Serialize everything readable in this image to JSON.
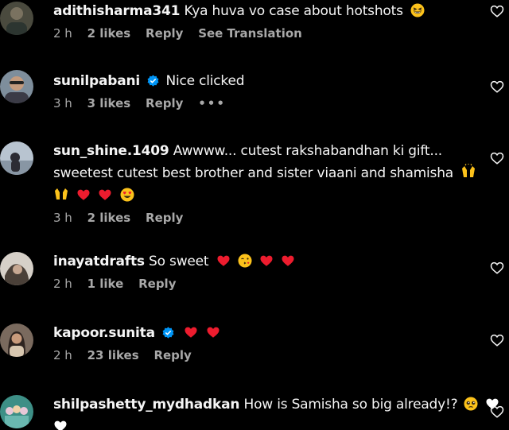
{
  "comments": [
    {
      "username": "adithisharma341",
      "text": "Kya huva vo case about hotshots",
      "emojis": [
        "grinning-squinting-face"
      ],
      "time": "2 h",
      "likes": "2 likes",
      "reply": "Reply",
      "extra": "See Translation",
      "avatar_color": "#5a5a4a"
    },
    {
      "username": "sunilpabani",
      "verified": true,
      "text": "Nice clicked",
      "time": "3 h",
      "likes": "3 likes",
      "reply": "Reply",
      "more": "•••",
      "avatar_color": "#6b7b8a"
    },
    {
      "username": "sun_shine.1409",
      "text": "Awwww... cutest rakshabandhan ki gift...",
      "text2": "sweetest cutest best brother and sister viaani and shamisha",
      "emojis_line2": [
        "raising-hands"
      ],
      "emojis_line3": [
        "raising-hands",
        "red-heart",
        "red-heart",
        "heart-eyes-face"
      ],
      "time": "3 h",
      "likes": "2 likes",
      "reply": "Reply",
      "avatar_color": "#9aa6b4"
    },
    {
      "username": "inayatdrafts",
      "text": "So sweet",
      "emojis": [
        "red-heart",
        "face-blowing-kiss",
        "red-heart",
        "red-heart"
      ],
      "time": "2 h",
      "likes": "1 like",
      "reply": "Reply",
      "avatar_color": "#cfc8c0"
    },
    {
      "username": "kapoor.sunita",
      "verified": true,
      "text": "",
      "emojis": [
        "red-heart",
        "red-heart"
      ],
      "time": "2 h",
      "likes": "23 likes",
      "reply": "Reply",
      "avatar_color": "#6e5a4c"
    },
    {
      "username": "shilpashetty_mydhadkan",
      "text": "How is Samisha so big already!?",
      "emojis": [
        "pleading-face",
        "white-heart",
        "white-heart"
      ],
      "avatar_color": "#3d8f86"
    }
  ],
  "colors": {
    "background": "#000000",
    "text": "#f5f5f5",
    "secondary": "#a8a8a8",
    "verified": "#0095f6",
    "heart": "#ed1c2e",
    "emoji_yellow": "#fcc21b"
  }
}
